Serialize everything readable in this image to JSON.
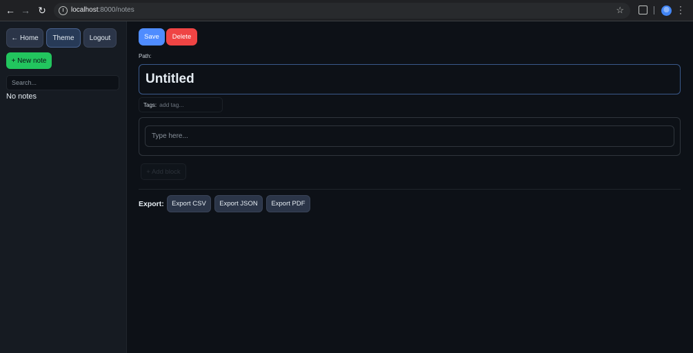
{
  "browser": {
    "back_icon": "arrow-left-icon",
    "forward_icon": "arrow-right-icon",
    "reload_icon": "reload-icon",
    "url_host": "localhost",
    "url_path": ":8000/notes",
    "bookmark_icon": "star-icon",
    "extensions_icon": "puzzle-icon",
    "profile_icon": "avatar-icon",
    "menu_icon": "more-vert-icon"
  },
  "sidebar": {
    "home_label": "← Home",
    "theme_label": "Theme",
    "logout_label": "Logout",
    "new_note_label": "+ New note",
    "search_placeholder": "Search...",
    "empty_text": "No notes"
  },
  "editor": {
    "save_label": "Save",
    "delete_label": "Delete",
    "path_label": "Path:",
    "title_value": "Untitled",
    "tags_label": "Tags:",
    "tags_placeholder": "add tag...",
    "block_placeholder": "Type here...",
    "add_block_label": "+ Add block"
  },
  "export": {
    "label": "Export:",
    "buttons": [
      "Export CSV",
      "Export JSON",
      "Export PDF"
    ]
  },
  "colors": {
    "accent_blue": "#4f8cff",
    "danger_red": "#ef4444",
    "success_green": "#22c55e",
    "background": "#0d1117",
    "sidebar_bg": "#161b22"
  }
}
